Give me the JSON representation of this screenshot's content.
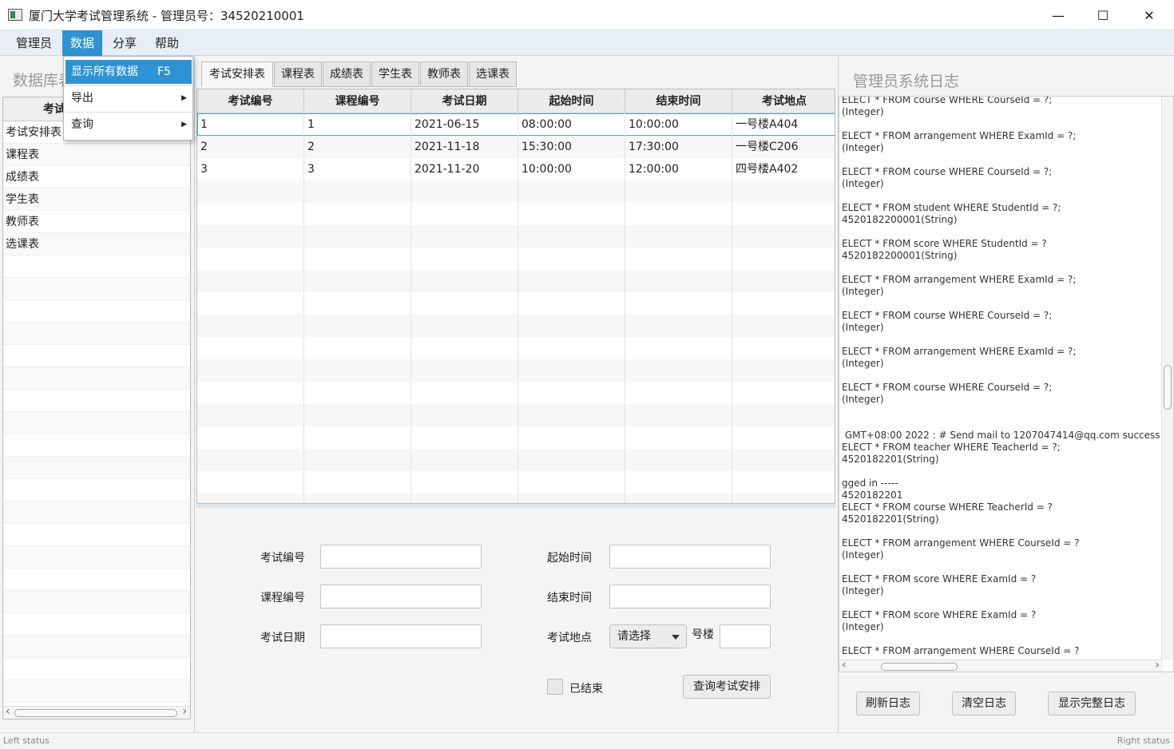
{
  "window": {
    "title": "厦门大学考试管理系统 - 管理员号：34520210001",
    "minimize": "—",
    "maximize": "☐",
    "close": "✕"
  },
  "menubar": {
    "items": [
      "管理员",
      "数据",
      "分享",
      "帮助"
    ],
    "active_index": 1
  },
  "dropdown": {
    "show_all": "显示所有数据",
    "show_all_shortcut": "F5",
    "export": "导出",
    "query": "查询",
    "submenu_arrow": "▶"
  },
  "left": {
    "title": "数据库表",
    "header": "考试",
    "rows": [
      "考试安排表",
      "课程表",
      "成绩表",
      "学生表",
      "教师表",
      "选课表"
    ],
    "scroll_left": "‹",
    "scroll_right": "›"
  },
  "tabs": [
    "考试安排表",
    "课程表",
    "成绩表",
    "学生表",
    "教师表",
    "选课表"
  ],
  "table": {
    "columns": [
      "考试编号",
      "课程编号",
      "考试日期",
      "起始时间",
      "结束时间",
      "考试地点"
    ],
    "rows": [
      [
        "1",
        "1",
        "2021-06-15",
        "08:00:00",
        "10:00:00",
        "一号楼A404"
      ],
      [
        "2",
        "2",
        "2021-11-18",
        "15:30:00",
        "17:30:00",
        "一号楼C206"
      ],
      [
        "3",
        "3",
        "2021-11-20",
        "10:00:00",
        "12:00:00",
        "四号楼A402"
      ]
    ]
  },
  "form": {
    "exam_id_label": "考试编号",
    "course_id_label": "课程编号",
    "exam_date_label": "考试日期",
    "start_time_label": "起始时间",
    "end_time_label": "结束时间",
    "location_label": "考试地点",
    "location_select": "请选择",
    "building_suffix": "号楼",
    "finished_label": "已结束",
    "query_button": "查询考试安排"
  },
  "right": {
    "title": "管理员系统日志",
    "log_lines": [
      "ELECT * FROM course WHERE CourseId = ?;",
      "(Integer)",
      "",
      "ELECT * FROM arrangement WHERE ExamId = ?;",
      "(Integer)",
      "",
      "ELECT * FROM course WHERE CourseId = ?;",
      "(Integer)",
      "",
      "ELECT * FROM student WHERE StudentId = ?;",
      "4520182200001(String)",
      "",
      "ELECT * FROM score WHERE StudentId = ?",
      "4520182200001(String)",
      "",
      "ELECT * FROM arrangement WHERE ExamId = ?;",
      "(Integer)",
      "",
      "ELECT * FROM course WHERE CourseId = ?;",
      "(Integer)",
      "",
      "ELECT * FROM arrangement WHERE ExamId = ?;",
      "(Integer)",
      "",
      "ELECT * FROM course WHERE CourseId = ?;",
      "(Integer)",
      "",
      "",
      " GMT+08:00 2022 : # Send mail to 1207047414@qq.com success -----",
      "ELECT * FROM teacher WHERE TeacherId = ?;",
      "4520182201(String)",
      "",
      "gged in -----",
      "4520182201",
      "ELECT * FROM course WHERE TeacherId = ?",
      "4520182201(String)",
      "",
      "ELECT * FROM arrangement WHERE CourseId = ?",
      "(Integer)",
      "",
      "ELECT * FROM score WHERE ExamId = ?",
      "(Integer)",
      "",
      "ELECT * FROM score WHERE ExamId = ?",
      "(Integer)",
      "",
      "ELECT * FROM arrangement WHERE CourseId = ?"
    ],
    "refresh_button": "刷新日志",
    "clear_button": "清空日志",
    "full_button": "显示完整日志",
    "scroll_left": "‹",
    "scroll_right": "›"
  },
  "status": {
    "left": "Left status",
    "right": "Right status"
  }
}
